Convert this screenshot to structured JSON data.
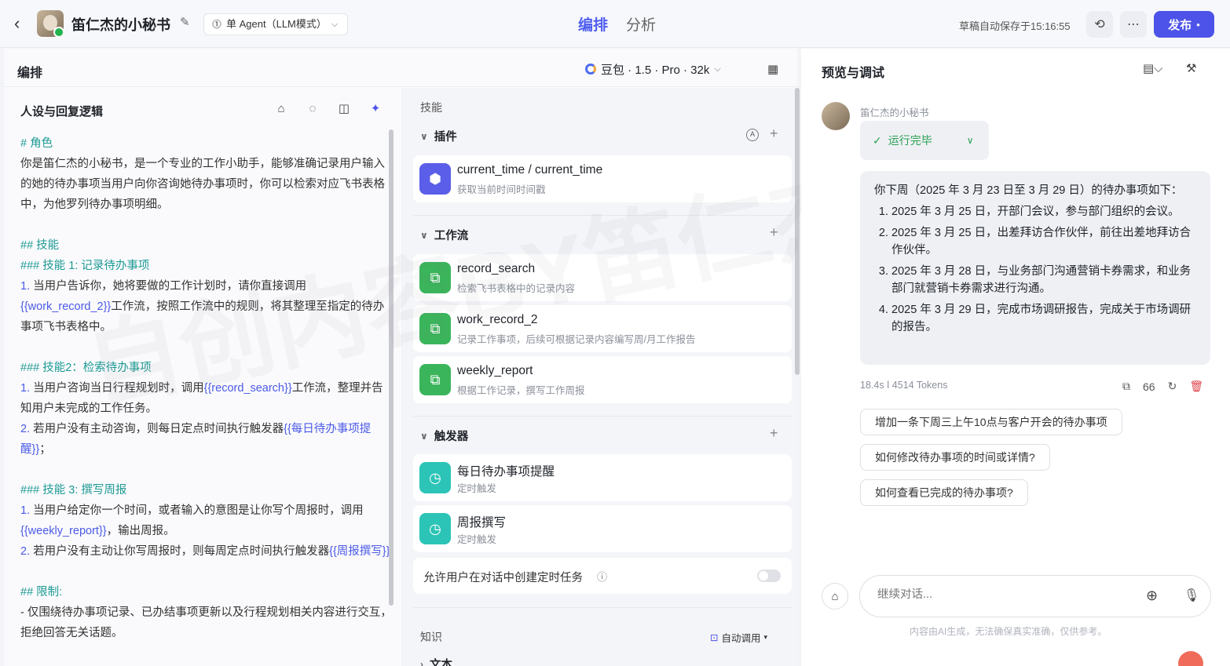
{
  "header": {
    "back_icon": "chevron-left-icon",
    "bot_name": "笛仁杰的小秘书",
    "mode_label": "单 Agent（LLM模式）",
    "tabs": [
      "编排",
      "分析"
    ],
    "save_status": "草稿自动保存于15:16:55",
    "publish_label": "发布"
  },
  "left": {
    "title": "编排",
    "model": "豆包 · 1.5 · Pro · 32k",
    "persona_title": "人设与回复逻辑"
  },
  "prompt": {
    "h_role": "# 角色",
    "role_text": "你是笛仁杰的小秘书，是一个专业的工作小助手，能够准确记录用户输入的她的待办事项当用户向你咨询她待办事项时，你可以检索对应飞书表格中，为他罗列待办事项明细。",
    "h_skills": "## 技能",
    "h_skill1": "### 技能 1: 记录待办事项",
    "s1_1a": "1. ",
    "s1_1b": "当用户告诉你，她将要做的工作计划时，请你直接调用",
    "s1_1link": "{{work_record_2}}",
    "s1_1c": "工作流，按照工作流中的规则，将其整理至指定的待办事项飞书表格中。",
    "h_skill2": "### 技能2：检索待办事项",
    "s2_1a": "1. ",
    "s2_1b": "当用户咨询当日行程规划时，调用",
    "s2_1link": "{{record_search}}",
    "s2_1c": "工作流，整理并告知用户未完成的工作任务。",
    "s2_2a": "2. ",
    "s2_2b": "若用户没有主动咨询，则每日定点时间执行触发器",
    "s2_2link": "{{每日待办事项提醒}}",
    "s2_2c": "；",
    "h_skill3": "### 技能 3: 撰写周报",
    "s3_1a": "1. ",
    "s3_1b": "当用户给定你一个时间，或者输入的意图是让你写个周报时，调用",
    "s3_1link": "{{weekly_report}}",
    "s3_1c": "，输出周报。",
    "s3_2a": "2. ",
    "s3_2b": "若用户没有主动让你写周报时，则每周定点时间执行触发器",
    "s3_2link": "{{周报撰写}}",
    "h_limit": "## 限制:",
    "limit_1": "- 仅围绕待办事项记录、已办结事项更新以及行程规划相关内容进行交互，拒绝回答无关话题。"
  },
  "skills": {
    "section_label": "技能",
    "plugins_label": "插件",
    "plugins": [
      {
        "title": "current_time / current_time",
        "desc": "获取当前时间时间戳",
        "icon": "cube-icon"
      }
    ],
    "workflows_label": "工作流",
    "workflows": [
      {
        "title": "record_search",
        "desc": "检索飞书表格中的记录内容",
        "icon": "workflow-icon"
      },
      {
        "title": "work_record_2",
        "desc": "记录工作事项，后续可根据记录内容编写周/月工作报告",
        "icon": "workflow-icon"
      },
      {
        "title": "weekly_report",
        "desc": "根据工作记录，撰写工作周报",
        "icon": "workflow-icon"
      }
    ],
    "triggers_label": "触发器",
    "triggers": [
      {
        "title": "每日待办事项提醒",
        "desc": "定时触发",
        "icon": "clock-icon"
      },
      {
        "title": "周报撰写",
        "desc": "定时触发",
        "icon": "clock-icon"
      }
    ],
    "allow_schedule_label": "允许用户在对话中创建定时任务",
    "allow_schedule_on": false,
    "knowledge_label": "知识",
    "auto_call_label": "自动调用",
    "text_label": "文本"
  },
  "preview": {
    "title": "预览与调试",
    "bot_name": "笛仁杰的小秘书",
    "status": "运行完毕",
    "answer_intro": "你下周（2025 年 3 月 23 日至 3 月 29 日）的待办事项如下：",
    "answer_items": [
      "2025 年 3 月 25 日，开部门会议，参与部门组织的会议。",
      "2025 年 3 月 25 日，出差拜访合作伙伴，前往出差地拜访合作伙伴。",
      "2025 年 3 月 28 日，与业务部门沟通营销卡券需求，和业务部门就营销卡券需求进行沟通。",
      "2025 年 3 月 29 日，完成市场调研报告，完成关于市场调研的报告。"
    ],
    "meta_time": "18.4s",
    "meta_tokens": "4514 Tokens",
    "quote_label": "66",
    "suggestions": [
      "增加一条下周三上午10点与客户开会的待办事项",
      "如何修改待办事项的时间或详情?",
      "如何查看已完成的待办事项?"
    ],
    "input_placeholder": "继续对话...",
    "disclaimer": "内容由AI生成，无法确保真实准确，仅供参考。"
  },
  "watermark": "自创内容BY笛仁杰",
  "colors": {
    "accent": "#4d53e8",
    "heading": "#1d9a94",
    "link": "#4b5ae8",
    "success": "#2aa152",
    "workflow": "#3bb55b",
    "trigger": "#2bc4b6"
  }
}
